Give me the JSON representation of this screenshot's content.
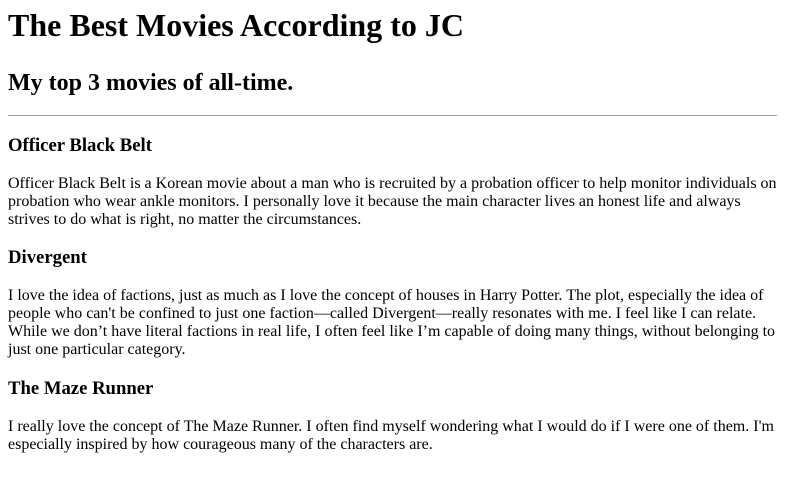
{
  "page": {
    "title": "The Best Movies According to JC",
    "subtitle": "My top 3 movies of all-time."
  },
  "movies": [
    {
      "title": "Officer Black Belt",
      "description": "Officer Black Belt is a Korean movie about a man who is recruited by a probation officer to help monitor individuals on probation who wear ankle monitors. I personally love it because the main character lives an honest life and always strives to do what is right, no matter the circumstances."
    },
    {
      "title": "Divergent",
      "description": "I love the idea of factions, just as much as I love the concept of houses in Harry Potter. The plot, especially the idea of people who can't be confined to just one faction—called Divergent—really resonates with me. I feel like I can relate. While we don’t have literal factions in real life, I often feel like I’m capable of doing many things, without belonging to just one particular category."
    },
    {
      "title": "The Maze Runner",
      "description": "I really love the concept of The Maze Runner. I often find myself wondering what I would do if I were one of them. I'm especially inspired by how courageous many of the characters are."
    }
  ]
}
